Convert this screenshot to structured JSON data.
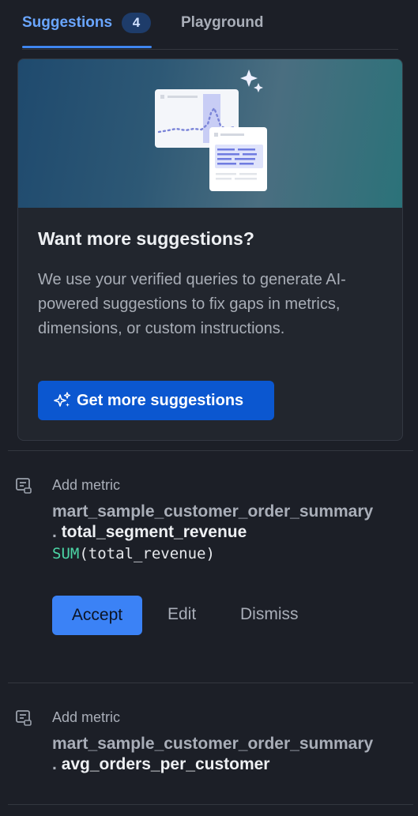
{
  "tabs": {
    "suggestions_label": "Suggestions",
    "suggestions_count": "4",
    "playground_label": "Playground"
  },
  "promo": {
    "title": "Want more suggestions?",
    "description": "We use your verified queries to generate AI-powered suggestions to fix gaps in metrics, dimensions, or custom instructions.",
    "button_label": "Get more suggestions",
    "button_icon": "sparkles-icon"
  },
  "suggestions": [
    {
      "type_label": "Add metric",
      "icon": "metric-icon",
      "table": "mart_sample_customer_order_summary",
      "dot": ".",
      "field": "total_segment_revenue",
      "expr_fn": "SUM",
      "expr_args": "(total_revenue)",
      "accept_label": "Accept",
      "edit_label": "Edit",
      "dismiss_label": "Dismiss"
    },
    {
      "type_label": "Add metric",
      "icon": "metric-icon",
      "table": "mart_sample_customer_order_summary",
      "dot": ".",
      "field": "avg_orders_per_customer"
    }
  ],
  "colors": {
    "background": "#1c1f27",
    "accent": "#3b82f6",
    "primary_button": "#0b57d0",
    "function_keyword": "#4cd6a6"
  }
}
